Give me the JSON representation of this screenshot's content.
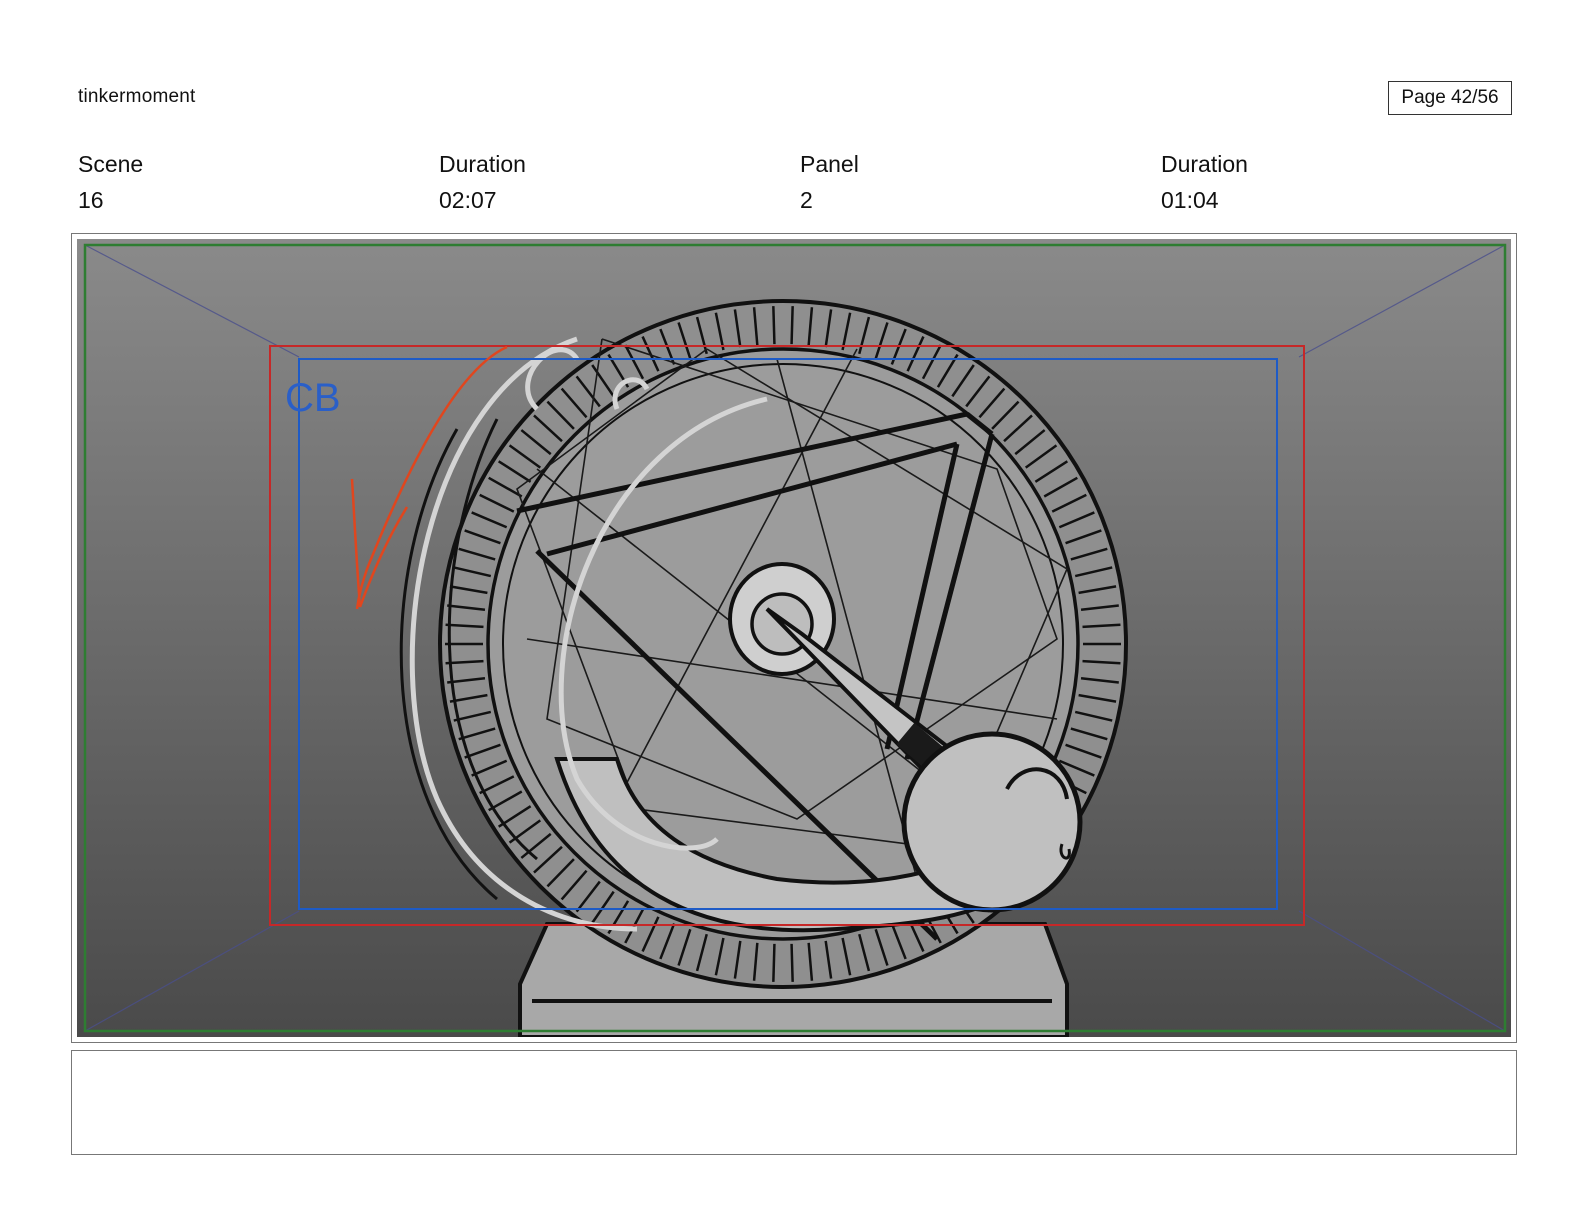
{
  "header": {
    "project": "tinkermoment",
    "page": "Page 42/56"
  },
  "meta": {
    "scene_label": "Scene",
    "scene_value": "16",
    "scene_duration_label": "Duration",
    "scene_duration_value": "02:07",
    "panel_label": "Panel",
    "panel_value": "2",
    "panel_duration_label": "Duration",
    "panel_duration_value": "01:04"
  },
  "panel": {
    "initials": "CB",
    "colors": {
      "safe_outer": "#2e7d32",
      "action_safe": "#c62828",
      "title_safe": "#1e5bc6",
      "motion_arrow": "#e0461e"
    }
  },
  "notes": {
    "text": ""
  }
}
